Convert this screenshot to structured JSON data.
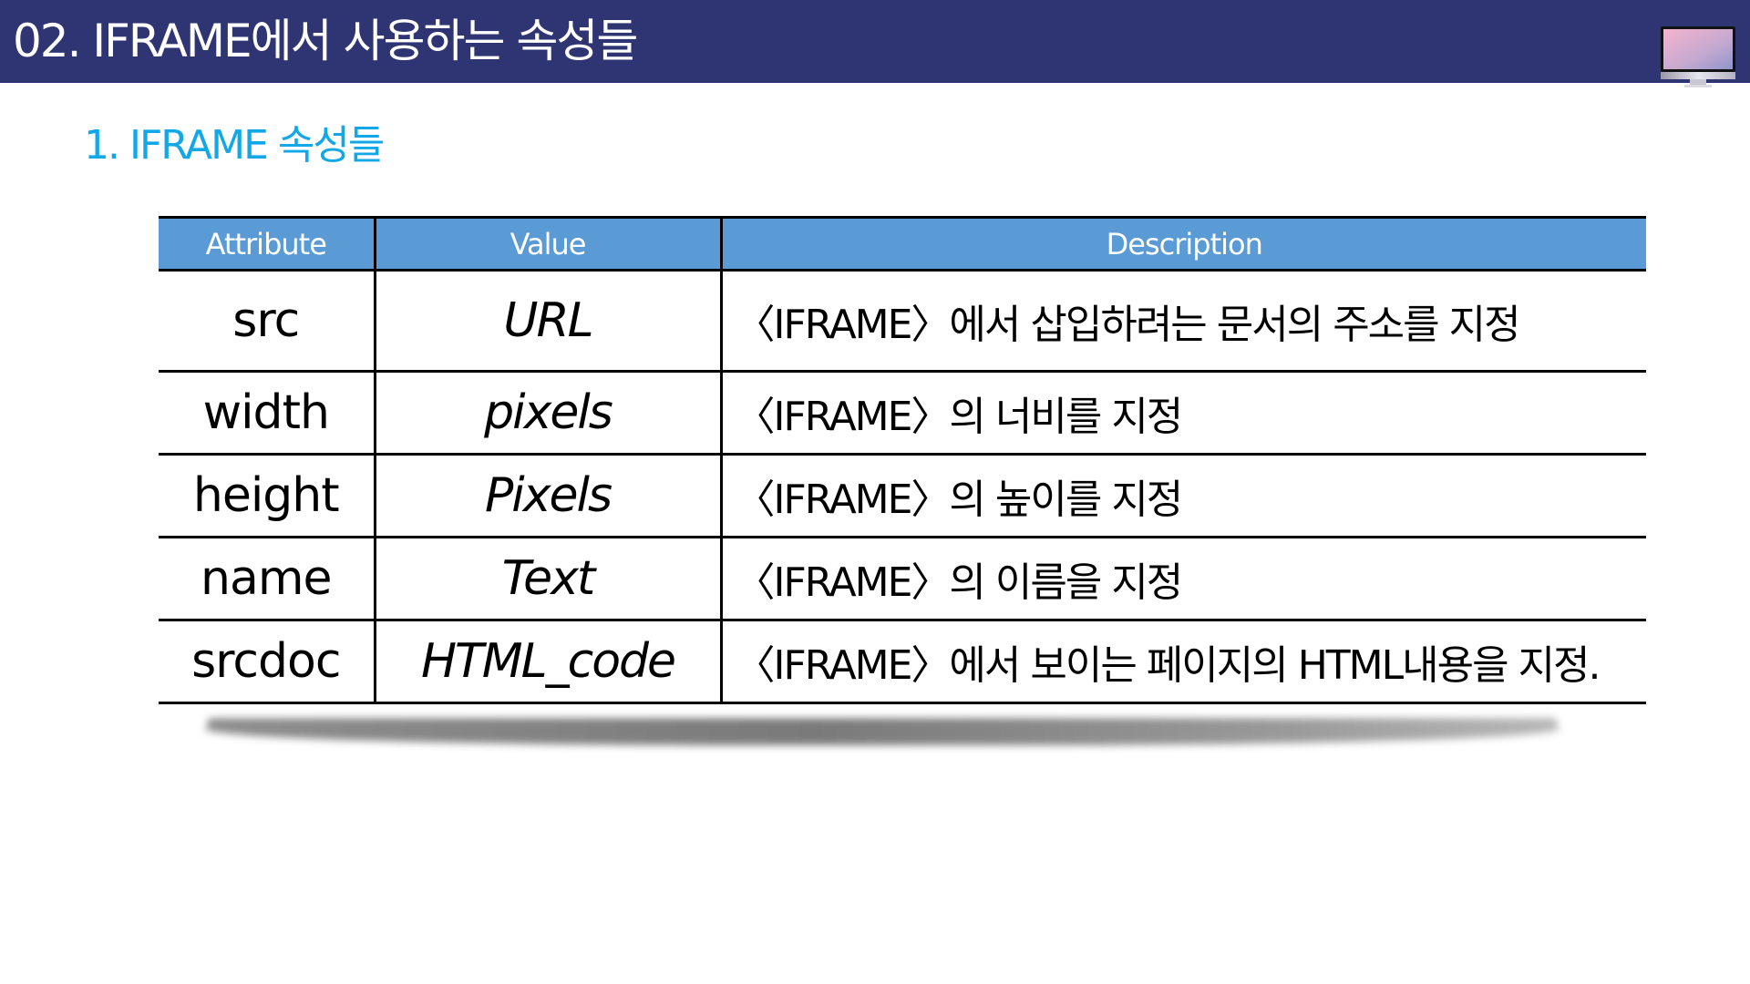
{
  "header": {
    "title": "02. IFRAME에서 사용하는 속성들",
    "icon": "desktop-monitor-icon"
  },
  "section": {
    "subtitle": "1. IFRAME 속성들"
  },
  "colors": {
    "title_bar": "#2f3572",
    "subtitle": "#12a8e8",
    "table_header": "#5b9bd5"
  },
  "table": {
    "columns": [
      "Attribute",
      "Value",
      "Description"
    ],
    "rows": [
      {
        "attribute": "src",
        "value": "URL",
        "description": "〈IFRAME〉에서 삽입하려는 문서의 주소를 지정"
      },
      {
        "attribute": "width",
        "value": "pixels",
        "description": "〈IFRAME〉의 너비를 지정"
      },
      {
        "attribute": "height",
        "value": "Pixels",
        "description": "〈IFRAME〉의 높이를 지정"
      },
      {
        "attribute": "name",
        "value": "Text",
        "description": "〈IFRAME〉의 이름을 지정"
      },
      {
        "attribute": "srcdoc",
        "value": "HTML_code",
        "description": "〈IFRAME〉에서 보이는 페이지의 HTML내용을 지정."
      }
    ]
  }
}
